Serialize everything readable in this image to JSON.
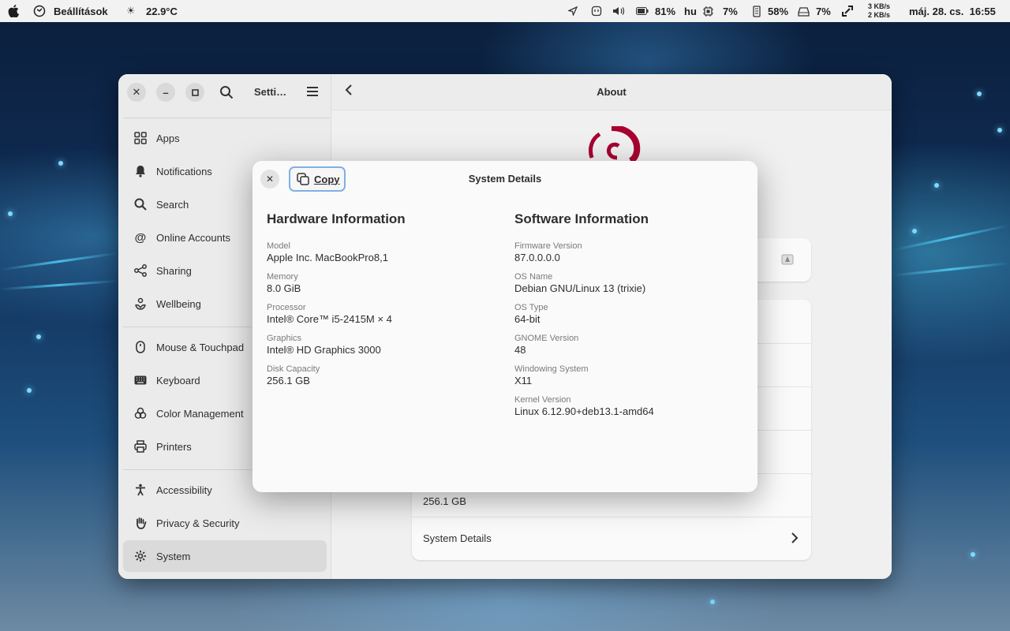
{
  "topbar": {
    "apple_icon": "apple-logo-icon",
    "app_name": "Beállítások",
    "weather_temp": "22.9°C",
    "battery_percent": "81%",
    "keyboard_layout": "hu",
    "cpu_percent": "7%",
    "memory_percent": "58%",
    "disk_percent": "7%",
    "net_up": "3 KB/s",
    "net_down": "2 KB/s",
    "datetime": "máj. 28. cs.  16:55"
  },
  "settings_window": {
    "sidebar_title": "Setti…",
    "sidebar_items": [
      {
        "label": "Apps",
        "icon": "apps-grid-icon"
      },
      {
        "label": "Notifications",
        "icon": "bell-icon"
      },
      {
        "label": "Search",
        "icon": "search-icon"
      },
      {
        "label": "Online Accounts",
        "icon": "at-sign-icon"
      },
      {
        "label": "Sharing",
        "icon": "share-icon"
      },
      {
        "label": "Wellbeing",
        "icon": "wellbeing-icon"
      },
      {
        "label": "Mouse & Touchpad",
        "icon": "mouse-icon"
      },
      {
        "label": "Keyboard",
        "icon": "keyboard-icon"
      },
      {
        "label": "Color Management",
        "icon": "color-management-icon"
      },
      {
        "label": "Printers",
        "icon": "printer-icon"
      },
      {
        "label": "Accessibility",
        "icon": "accessibility-icon"
      },
      {
        "label": "Privacy & Security",
        "icon": "hand-icon"
      },
      {
        "label": "System",
        "icon": "gear-icon"
      }
    ],
    "active_item": "System",
    "main_title": "About",
    "disk_capacity_value": "256.1 GB",
    "system_details_label": "System Details"
  },
  "dialog": {
    "title": "System Details",
    "copy_label": "Copy",
    "hardware": {
      "heading": "Hardware Information",
      "fields": [
        {
          "label": "Model",
          "value": "Apple Inc. MacBookPro8,1"
        },
        {
          "label": "Memory",
          "value": "8.0 GiB"
        },
        {
          "label": "Processor",
          "value": "Intel® Core™ i5-2415M × 4"
        },
        {
          "label": "Graphics",
          "value": "Intel® HD Graphics 3000"
        },
        {
          "label": "Disk Capacity",
          "value": "256.1 GB"
        }
      ]
    },
    "software": {
      "heading": "Software Information",
      "fields": [
        {
          "label": "Firmware Version",
          "value": "87.0.0.0.0"
        },
        {
          "label": "OS Name",
          "value": "Debian GNU/Linux 13 (trixie)"
        },
        {
          "label": "OS Type",
          "value": "64-bit"
        },
        {
          "label": "GNOME Version",
          "value": "48"
        },
        {
          "label": "Windowing System",
          "value": "X11"
        },
        {
          "label": "Kernel Version",
          "value": "Linux 6.12.90+deb13.1-amd64"
        }
      ]
    }
  },
  "colors": {
    "debian_red": "#a80030",
    "copy_focus_ring": "#7fb0e4"
  }
}
